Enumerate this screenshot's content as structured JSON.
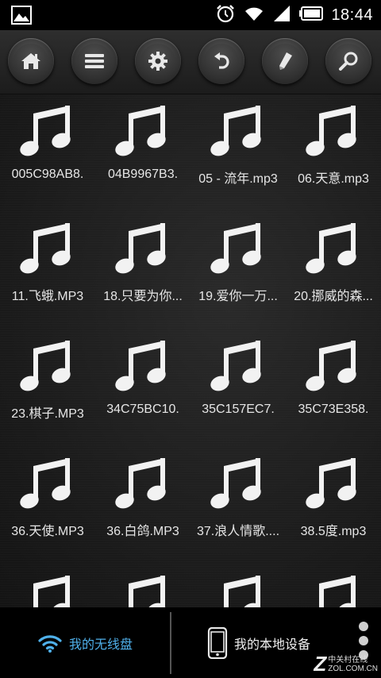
{
  "status_bar": {
    "time": "18:44"
  },
  "toolbar": {
    "buttons": [
      {
        "name": "home-button",
        "icon": "home-icon"
      },
      {
        "name": "menu-button",
        "icon": "list-icon"
      },
      {
        "name": "settings-button",
        "icon": "gear-icon"
      },
      {
        "name": "back-button",
        "icon": "undo-icon"
      },
      {
        "name": "edit-button",
        "icon": "pencil-icon"
      },
      {
        "name": "search-button",
        "icon": "search-icon"
      }
    ]
  },
  "files": [
    {
      "name": "005C98AB8."
    },
    {
      "name": "04B9967B3."
    },
    {
      "name": "05 - 流年.mp3"
    },
    {
      "name": "06.天意.mp3"
    },
    {
      "name": "11.飞蛾.MP3"
    },
    {
      "name": "18.只要为你..."
    },
    {
      "name": "19.爱你一万..."
    },
    {
      "name": "20.挪威的森..."
    },
    {
      "name": "23.棋子.MP3"
    },
    {
      "name": "34C75BC10."
    },
    {
      "name": "35C157EC7."
    },
    {
      "name": "35C73E358."
    },
    {
      "name": "36.天使.MP3"
    },
    {
      "name": "36.白鸽.MP3"
    },
    {
      "name": "37.浪人情歌...."
    },
    {
      "name": "38.5度.mp3"
    },
    {
      "name": ""
    },
    {
      "name": ""
    },
    {
      "name": ""
    },
    {
      "name": ""
    }
  ],
  "bottom_bar": {
    "wireless_label": "我的无线盘",
    "local_label": "我的本地设备"
  },
  "watermark": {
    "brand": "Z",
    "text": "中关村在线",
    "url": "ZOL.COM.CN"
  },
  "colors": {
    "accent": "#4fb0ea"
  }
}
